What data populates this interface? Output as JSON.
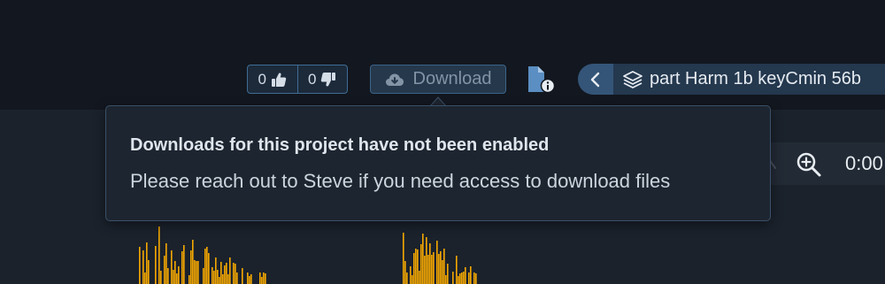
{
  "toolbar": {
    "likes": "0",
    "dislikes": "0",
    "download_label": "Download",
    "version_label": "part Harm 1b keyCmin 56b"
  },
  "tooltip": {
    "title": "Downloads for this project have not been enabled",
    "message": "Please reach out to Steve if you need access to download files"
  },
  "player": {
    "time": "0:00"
  },
  "icons": {
    "like": "thumbs-up-icon",
    "dislike": "thumbs-down-icon",
    "download": "cloud-download-icon",
    "file_info": "file-info-icon",
    "back": "chevron-left-icon",
    "version": "layers-icon",
    "zoom": "zoom-in-icon"
  },
  "colors": {
    "background": "#131720",
    "accent_border": "#3f6c95",
    "waveform": "#f5a800",
    "tooltip_background": "#1d2530"
  }
}
